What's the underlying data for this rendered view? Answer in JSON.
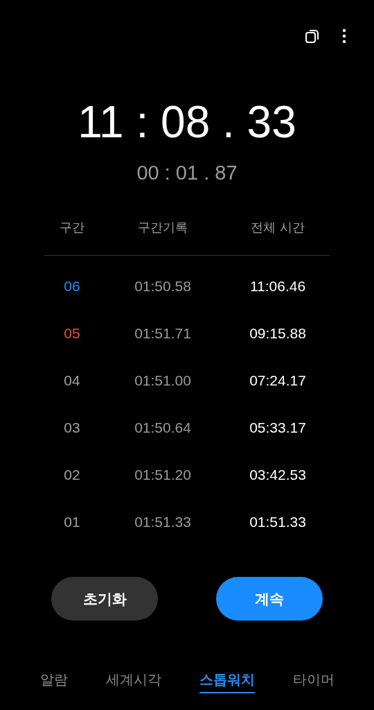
{
  "toolbar": {
    "actions": [
      {
        "kind": "copy"
      },
      {
        "kind": "more"
      }
    ]
  },
  "stopwatch": {
    "total": "11 : 08 . 33",
    "lap": "00 : 01 . 87"
  },
  "laps": {
    "columns": [
      "구간",
      "구간기록",
      "전체 시간"
    ],
    "rows": [
      {
        "number": "06",
        "color": "#1a8cff",
        "lap_time": "01:50.58",
        "total_time": "11:06.46"
      },
      {
        "number": "05",
        "color": "#f0483e",
        "lap_time": "01:51.71",
        "total_time": "09:15.88"
      },
      {
        "number": "04",
        "color": "#a0a0a0",
        "lap_time": "01:51.00",
        "total_time": "07:24.17"
      },
      {
        "number": "03",
        "color": "#a0a0a0",
        "lap_time": "01:50.64",
        "total_time": "05:33.17"
      },
      {
        "number": "02",
        "color": "#a0a0a0",
        "lap_time": "01:51.20",
        "total_time": "03:42.53"
      },
      {
        "number": "01",
        "color": "#a0a0a0",
        "lap_time": "01:51.33",
        "total_time": "01:51.33"
      }
    ]
  },
  "buttons": [
    {
      "label": "초기화",
      "kind": "secondary"
    },
    {
      "label": "계속",
      "kind": "primary"
    }
  ],
  "tabs": [
    {
      "label": "알람",
      "selected": false
    },
    {
      "label": "세계시각",
      "selected": false
    },
    {
      "label": "스톱워치",
      "selected": true
    },
    {
      "label": "타이머",
      "selected": false
    }
  ]
}
